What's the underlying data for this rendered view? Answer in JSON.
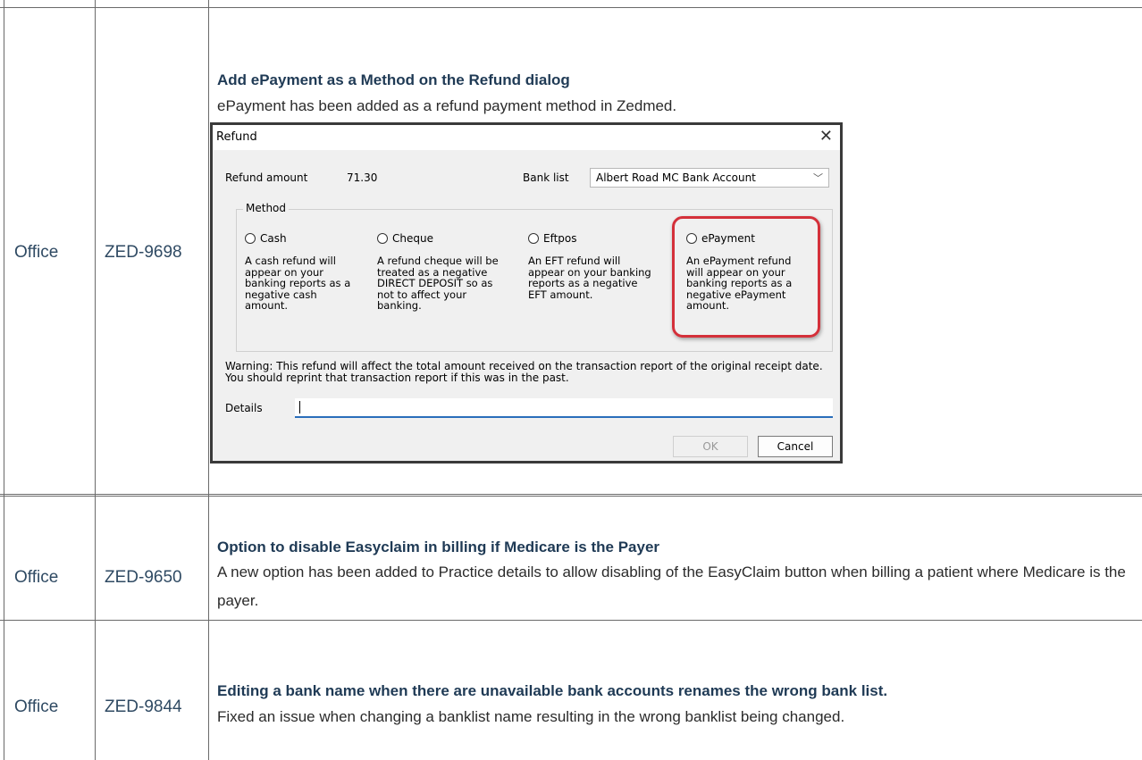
{
  "rows": [
    {
      "category": "Office",
      "ticket": "ZED-9698",
      "title": "Add ePayment as a Method on the Refund dialog",
      "description": "ePayment has been added as a refund payment method in Zedmed."
    },
    {
      "category": "Office",
      "ticket": "ZED-9650",
      "title": "Option to disable Easyclaim in billing if Medicare is the Payer",
      "description": "A new option has been added to Practice details to allow disabling of the EasyClaim button when billing a patient where Medicare is the payer."
    },
    {
      "category": "Office",
      "ticket": "ZED-9844",
      "title": "Editing a bank name when there are unavailable bank accounts renames the wrong bank list.",
      "description": "Fixed an issue when changing a banklist name resulting in the wrong banklist being changed."
    }
  ],
  "dialog": {
    "title": "Refund",
    "close_icon": "close-icon",
    "refund_amount_label": "Refund amount",
    "refund_amount_value": "71.30",
    "bank_list_label": "Bank list",
    "bank_list_value": "Albert Road MC Bank Account",
    "method_legend": "Method",
    "options": [
      {
        "label": "Cash",
        "description": "A cash refund will appear on your banking reports as a negative cash amount."
      },
      {
        "label": "Cheque",
        "description": "A refund cheque will be treated as a negative DIRECT DEPOSIT so as not to affect your banking."
      },
      {
        "label": "Eftpos",
        "description": "An EFT refund will appear on your banking reports as a negative EFT amount."
      },
      {
        "label": "ePayment",
        "description": "An ePayment refund will appear on your banking reports as a negative ePayment amount."
      }
    ],
    "warning": "Warning: This refund will affect the total amount received on the transaction report of the original receipt date. You should reprint that transaction report if this was in the past.",
    "details_label": "Details",
    "details_value": "",
    "ok_label": "OK",
    "cancel_label": "Cancel",
    "highlight_color": "#d4303a"
  }
}
